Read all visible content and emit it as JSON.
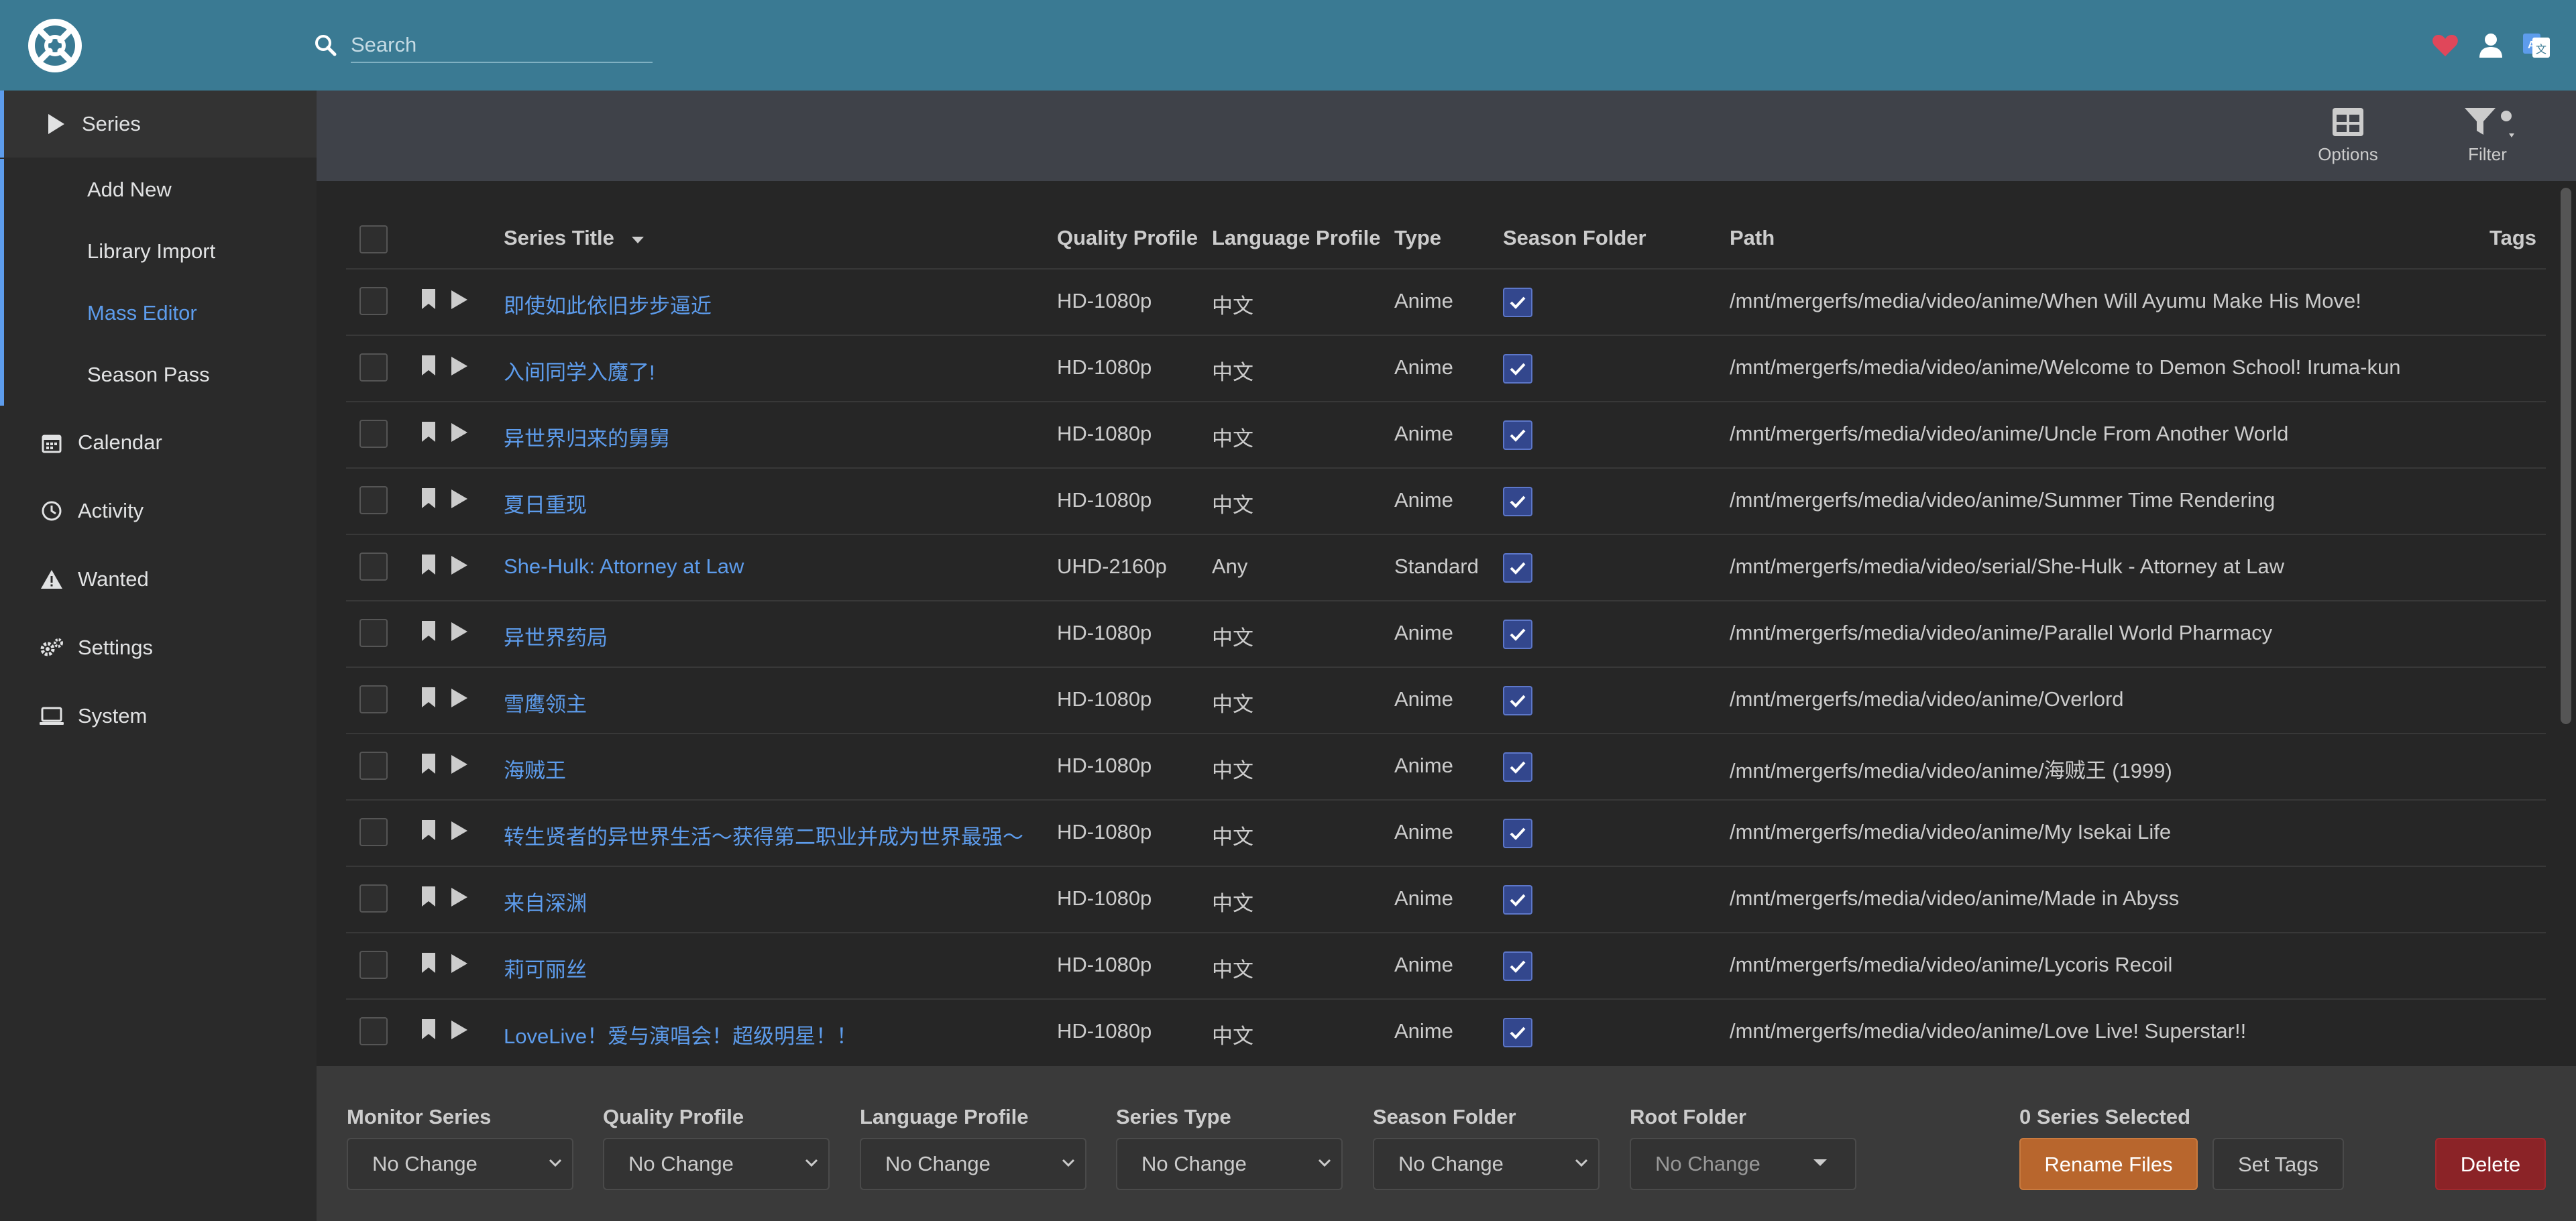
{
  "header": {
    "search_placeholder": "Search"
  },
  "sidebar": {
    "items": [
      {
        "label": "Series",
        "icon": "play-icon"
      },
      {
        "label": "Add New"
      },
      {
        "label": "Library Import"
      },
      {
        "label": "Mass Editor"
      },
      {
        "label": "Season Pass"
      },
      {
        "label": "Calendar",
        "icon": "calendar-icon"
      },
      {
        "label": "Activity",
        "icon": "clock-icon"
      },
      {
        "label": "Wanted",
        "icon": "warning-icon"
      },
      {
        "label": "Settings",
        "icon": "gears-icon"
      },
      {
        "label": "System",
        "icon": "laptop-icon"
      }
    ]
  },
  "toolbar": {
    "options_label": "Options",
    "filter_label": "Filter"
  },
  "table": {
    "columns": {
      "series_title": "Series Title",
      "quality_profile": "Quality Profile",
      "language_profile": "Language Profile",
      "type": "Type",
      "season_folder": "Season Folder",
      "path": "Path",
      "tags": "Tags"
    },
    "rows": [
      {
        "title": "即使如此依旧步步逼近",
        "quality": "HD-1080p",
        "language": "中文",
        "type": "Anime",
        "season_folder": true,
        "path": "/mnt/mergerfs/media/video/anime/When Will Ayumu Make His Move!"
      },
      {
        "title": "入间同学入魔了!",
        "quality": "HD-1080p",
        "language": "中文",
        "type": "Anime",
        "season_folder": true,
        "path": "/mnt/mergerfs/media/video/anime/Welcome to Demon School! Iruma-kun"
      },
      {
        "title": "异世界归来的舅舅",
        "quality": "HD-1080p",
        "language": "中文",
        "type": "Anime",
        "season_folder": true,
        "path": "/mnt/mergerfs/media/video/anime/Uncle From Another World"
      },
      {
        "title": "夏日重现",
        "quality": "HD-1080p",
        "language": "中文",
        "type": "Anime",
        "season_folder": true,
        "path": "/mnt/mergerfs/media/video/anime/Summer Time Rendering"
      },
      {
        "title": "She-Hulk: Attorney at Law",
        "quality": "UHD-2160p",
        "language": "Any",
        "type": "Standard",
        "season_folder": true,
        "path": "/mnt/mergerfs/media/video/serial/She-Hulk - Attorney at Law"
      },
      {
        "title": "异世界药局",
        "quality": "HD-1080p",
        "language": "中文",
        "type": "Anime",
        "season_folder": true,
        "path": "/mnt/mergerfs/media/video/anime/Parallel World Pharmacy"
      },
      {
        "title": "雪鹰领主",
        "quality": "HD-1080p",
        "language": "中文",
        "type": "Anime",
        "season_folder": true,
        "path": "/mnt/mergerfs/media/video/anime/Overlord"
      },
      {
        "title": "海贼王",
        "quality": "HD-1080p",
        "language": "中文",
        "type": "Anime",
        "season_folder": true,
        "path": "/mnt/mergerfs/media/video/anime/海贼王 (1999)"
      },
      {
        "title": "转生贤者的异世界生活～获得第二职业并成为世界最强～",
        "quality": "HD-1080p",
        "language": "中文",
        "type": "Anime",
        "season_folder": true,
        "path": "/mnt/mergerfs/media/video/anime/My Isekai Life"
      },
      {
        "title": "来自深渊",
        "quality": "HD-1080p",
        "language": "中文",
        "type": "Anime",
        "season_folder": true,
        "path": "/mnt/mergerfs/media/video/anime/Made in Abyss"
      },
      {
        "title": "莉可丽丝",
        "quality": "HD-1080p",
        "language": "中文",
        "type": "Anime",
        "season_folder": true,
        "path": "/mnt/mergerfs/media/video/anime/Lycoris Recoil"
      },
      {
        "title": "LoveLive！爱与演唱会！超级明星！！",
        "quality": "HD-1080p",
        "language": "中文",
        "type": "Anime",
        "season_folder": true,
        "path": "/mnt/mergerfs/media/video/anime/Love Live! Superstar!!"
      }
    ]
  },
  "footer": {
    "fields": [
      {
        "label": "Monitor Series",
        "value": "No Change"
      },
      {
        "label": "Quality Profile",
        "value": "No Change"
      },
      {
        "label": "Language Profile",
        "value": "No Change"
      },
      {
        "label": "Series Type",
        "value": "No Change"
      },
      {
        "label": "Season Folder",
        "value": "No Change"
      },
      {
        "label": "Root Folder",
        "value": "No Change"
      }
    ],
    "selected_count": "0 Series Selected",
    "rename_label": "Rename Files",
    "set_tags_label": "Set Tags",
    "delete_label": "Delete"
  },
  "colors": {
    "header": "#3a7a93",
    "accent": "#5d9cec",
    "rename": "#b8662d",
    "delete": "#8b2327"
  }
}
